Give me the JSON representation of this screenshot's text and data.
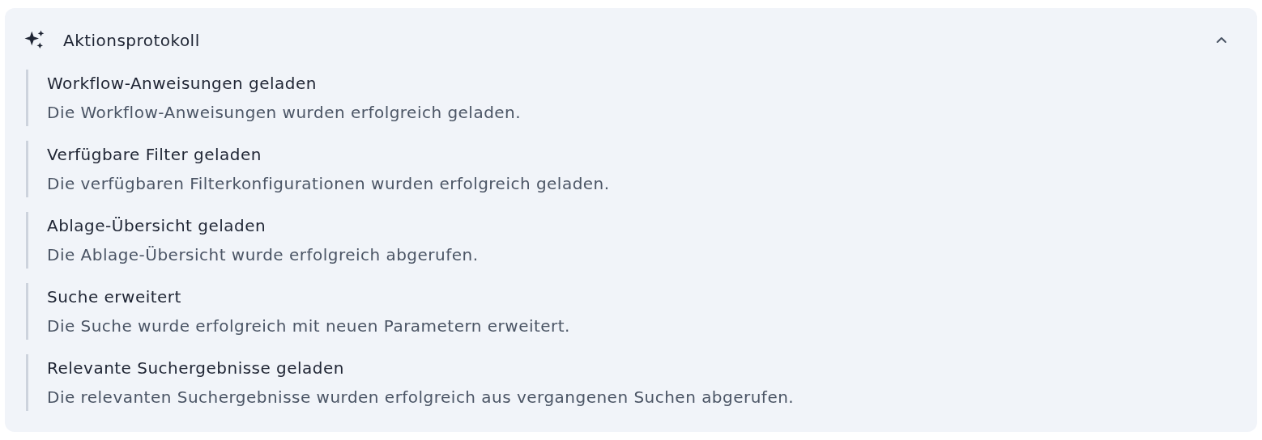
{
  "panel": {
    "title": "Aktionsprotokoll",
    "expanded": true,
    "entries": [
      {
        "title": "Workflow-Anweisungen geladen",
        "description": "Die Workflow-Anweisungen wurden erfolgreich geladen."
      },
      {
        "title": "Verfügbare Filter geladen",
        "description": "Die verfügbaren Filterkonfigurationen wurden erfolgreich geladen."
      },
      {
        "title": "Ablage-Übersicht geladen",
        "description": "Die Ablage-Übersicht wurde erfolgreich abgerufen."
      },
      {
        "title": "Suche erweitert",
        "description": "Die Suche wurde erfolgreich mit neuen Parametern erweitert."
      },
      {
        "title": "Relevante Suchergebnisse geladen",
        "description": "Die relevanten Suchergebnisse wurden erfolgreich aus vergangenen Suchen abgerufen."
      }
    ]
  }
}
